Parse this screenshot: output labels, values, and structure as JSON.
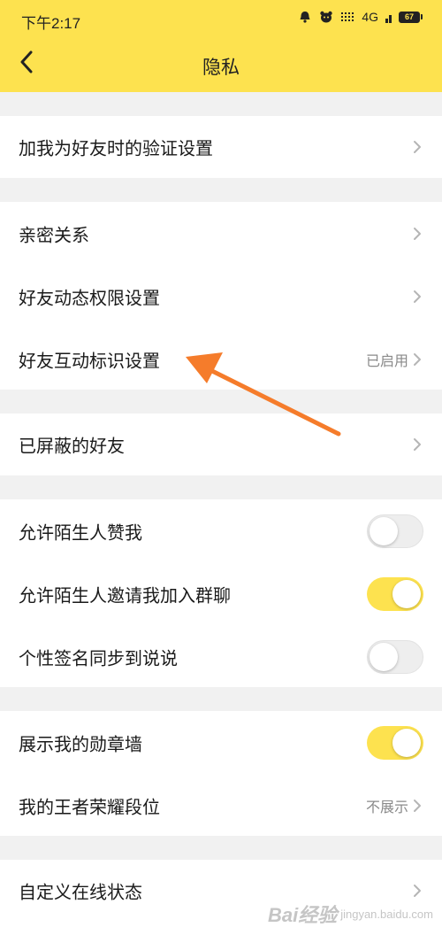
{
  "status_bar": {
    "time": "下午2:17",
    "network": "4G",
    "battery": "67",
    "icons": [
      "alarm-icon",
      "bear-icon",
      "signal-icon",
      "battery-icon"
    ]
  },
  "header": {
    "title": "隐私",
    "back_icon": "back-arrow-icon",
    "background": "#fde24f"
  },
  "groups": [
    {
      "rows": [
        {
          "label": "加我为好友时的验证设置",
          "type": "link"
        }
      ]
    },
    {
      "rows": [
        {
          "label": "亲密关系",
          "type": "link"
        },
        {
          "label": "好友动态权限设置",
          "type": "link"
        },
        {
          "label": "好友互动标识设置",
          "type": "link",
          "value": "已启用"
        }
      ]
    },
    {
      "rows": [
        {
          "label": "已屏蔽的好友",
          "type": "link"
        }
      ]
    },
    {
      "rows": [
        {
          "label": "允许陌生人赞我",
          "type": "toggle",
          "checked": false
        },
        {
          "label": "允许陌生人邀请我加入群聊",
          "type": "toggle",
          "checked": true
        },
        {
          "label": "个性签名同步到说说",
          "type": "toggle",
          "checked": false
        }
      ]
    },
    {
      "rows": [
        {
          "label": "展示我的勋章墙",
          "type": "toggle",
          "checked": true
        },
        {
          "label": "我的王者荣耀段位",
          "type": "link",
          "value": "不展示"
        }
      ]
    },
    {
      "rows": [
        {
          "label": "自定义在线状态",
          "type": "link"
        }
      ]
    }
  ],
  "annotation": {
    "color": "#f57c2b",
    "target": "好友互动标识设置"
  },
  "watermark": {
    "brand": "Bai经验",
    "sub": "jingyan.baidu.com"
  },
  "colors": {
    "accent": "#fde24f",
    "page_bg": "#f1f1f1",
    "text": "#1a1a1a",
    "secondary_text": "#8a8a8a"
  }
}
